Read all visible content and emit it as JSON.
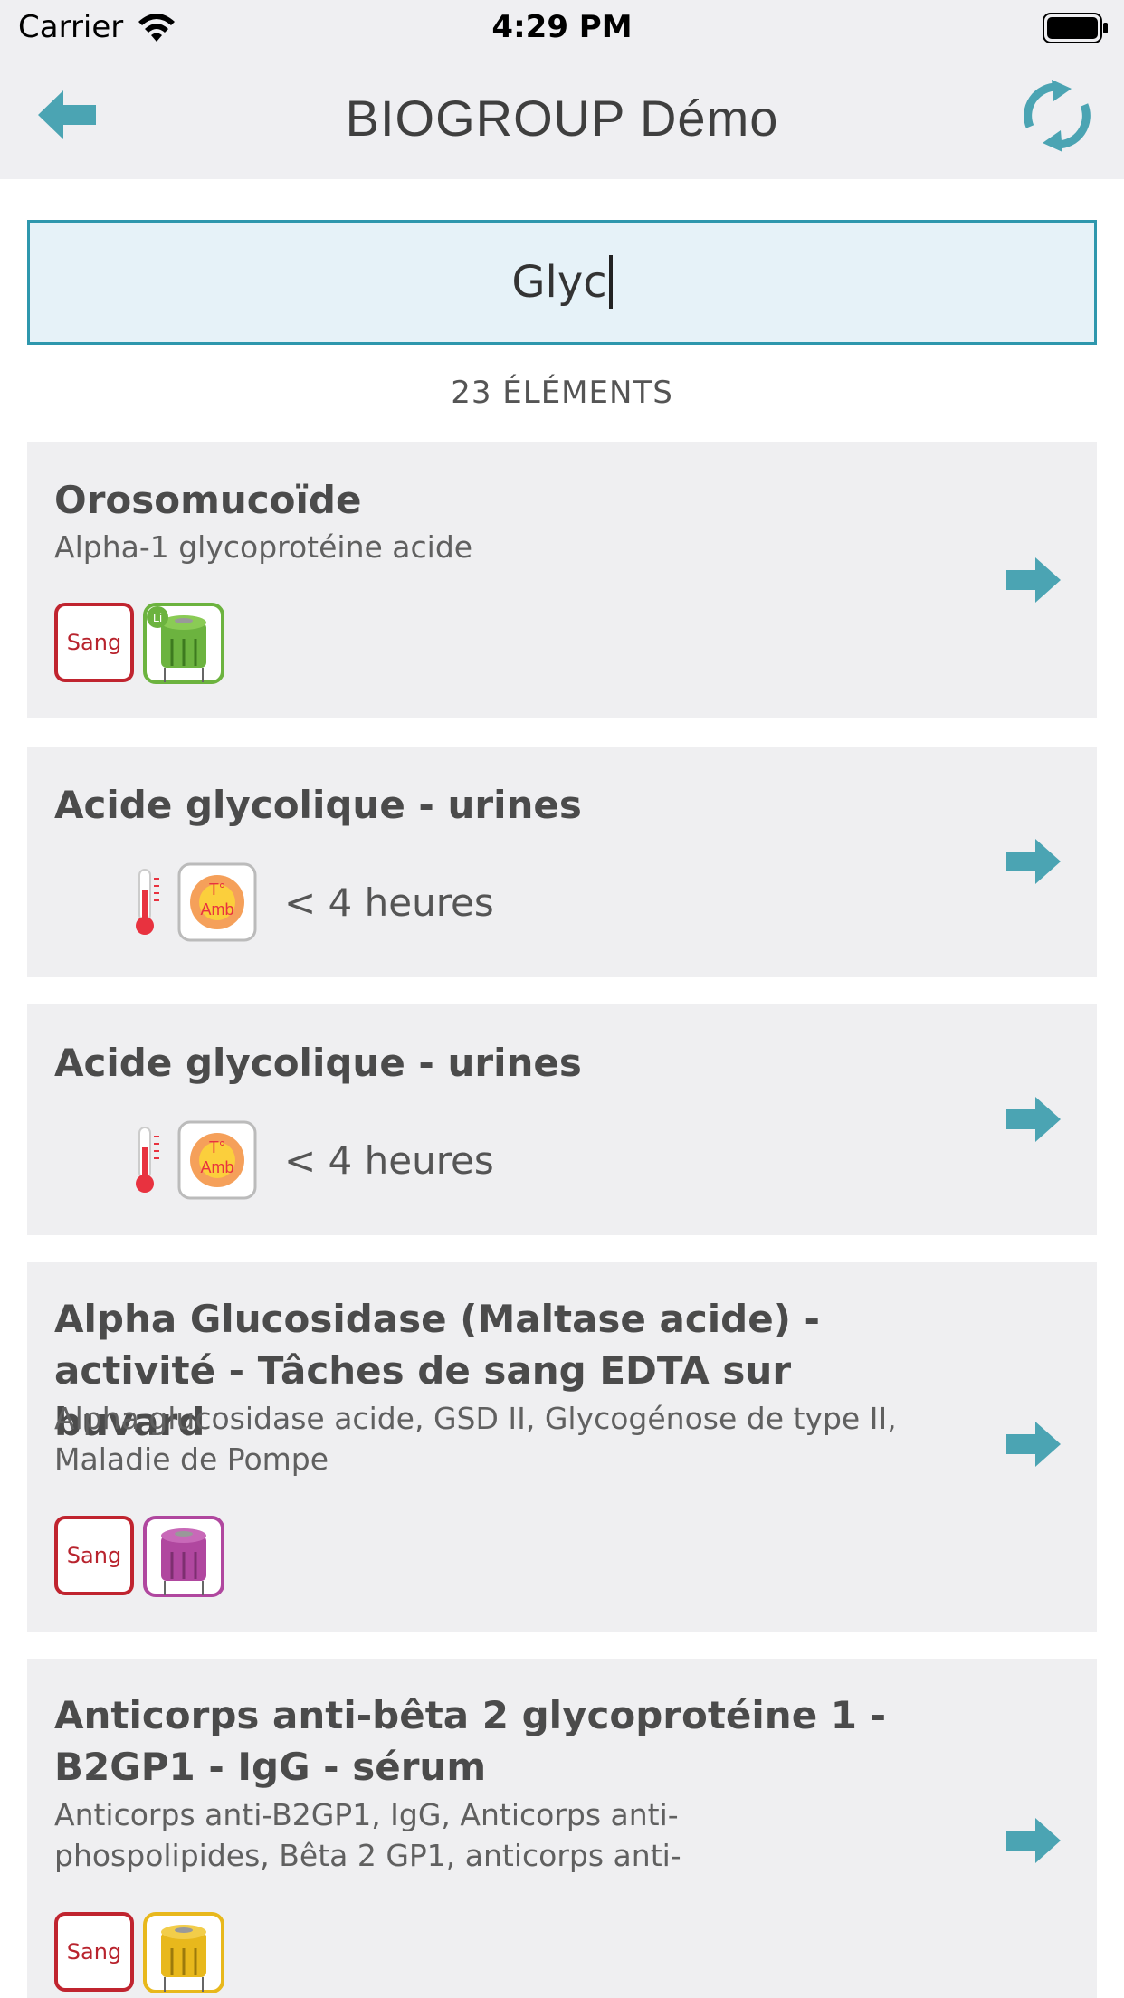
{
  "status_bar": {
    "carrier": "Carrier",
    "time": "4:29 PM"
  },
  "nav": {
    "title": "BIOGROUP Démo",
    "back_icon": "back-arrow-icon",
    "refresh_icon": "refresh-icon"
  },
  "search": {
    "value": "Glyc"
  },
  "results_count": "23 ÉLÉMENTS",
  "colors": {
    "accent": "#4ba4b3",
    "sang_red": "#c0242f",
    "tube_green": "#6cb33f",
    "tube_purple": "#b0479f",
    "tube_yellow": "#e8b81c"
  },
  "items": [
    {
      "title": "Orosomucoïde",
      "subtitle": "Alpha-1 glycoprotéine acide",
      "badge": "Sang",
      "tube_label": "Li"
    },
    {
      "title": "Acide glycolique - urines",
      "temp_label_1": "T°",
      "temp_label_2": "Amb",
      "condition": "< 4 heures"
    },
    {
      "title": "Acide glycolique - urines",
      "temp_label_1": "T°",
      "temp_label_2": "Amb",
      "condition": "< 4 heures"
    },
    {
      "title_line1": "Alpha Glucosidase (Maltase acide) -",
      "title_line2": "activité - Tâches de sang EDTA sur buvard",
      "subtitle_line1": "Alpha glucosidase acide, GSD II, Glycogénose de type II,",
      "subtitle_line2": "Maladie de Pompe",
      "badge": "Sang"
    },
    {
      "title_line1": "Anticorps anti-bêta 2 glycoprotéine 1 -",
      "title_line2": "B2GP1 - IgG - sérum",
      "subtitle_line1": "Anticorps anti-B2GP1, IgG, Anticorps anti-",
      "subtitle_line2": "phospolipides, Bêta 2 GP1, anticorps anti-",
      "badge": "Sang"
    }
  ]
}
